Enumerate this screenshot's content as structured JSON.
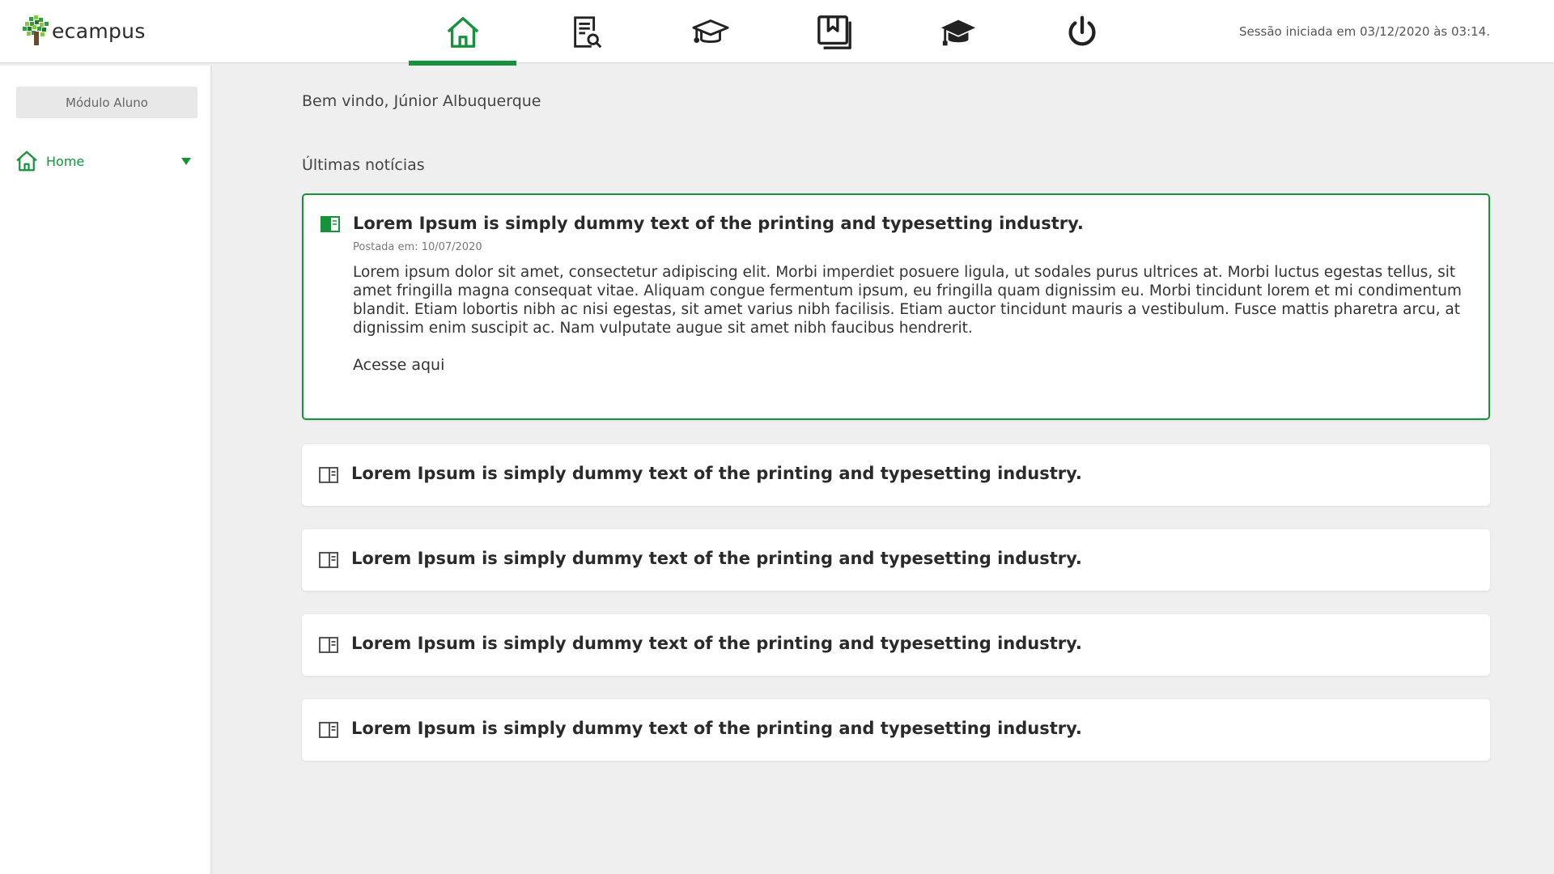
{
  "app": {
    "name": "ecampus"
  },
  "colors": {
    "accent": "#16923c",
    "icon_dark": "#222222",
    "background": "#efefef"
  },
  "header": {
    "nav": [
      {
        "icon": "home-icon",
        "active": true
      },
      {
        "icon": "document-search-icon",
        "active": false
      },
      {
        "icon": "graduation-cap-outline-icon",
        "active": false
      },
      {
        "icon": "bookmark-book-icon",
        "active": false
      },
      {
        "icon": "graduation-cap-solid-icon",
        "active": false
      },
      {
        "icon": "power-icon",
        "active": false
      }
    ],
    "session": "Sessão iniciada em 03/12/2020 às 03:14."
  },
  "sidebar": {
    "module_label": "Módulo Aluno",
    "items": [
      {
        "label": "Home",
        "icon": "home-icon"
      }
    ]
  },
  "main": {
    "welcome": "Bem vindo, Júnior Albuquerque",
    "news_title": "Últimas notícias",
    "news": [
      {
        "title": "Lorem Ipsum is simply dummy text of the printing and typesetting industry.",
        "date": "Postada em: 10/07/2020",
        "body": "Lorem ipsum dolor sit amet, consectetur adipiscing elit. Morbi imperdiet posuere ligula, ut sodales purus ultrices at. Morbi luctus egestas tellus, sit amet fringilla magna consequat vitae. Aliquam congue fermentum ipsum, eu fringilla quam dignissim eu. Morbi tincidunt lorem et mi condimentum blandit. Etiam lobortis nibh ac nisi egestas, sit amet varius nibh facilisis. Etiam auctor tincidunt mauris a vestibulum. Fusce mattis pharetra arcu, at dignissim enim suscipit ac. Nam vulputate augue sit amet nibh faucibus hendrerit.",
        "link": "Acesse aqui"
      },
      {
        "title": "Lorem Ipsum is simply dummy text of the printing and typesetting industry."
      },
      {
        "title": "Lorem Ipsum is simply dummy text of the printing and typesetting industry."
      },
      {
        "title": "Lorem Ipsum is simply dummy text of the printing and typesetting industry."
      },
      {
        "title": "Lorem Ipsum is simply dummy text of the printing and typesetting industry."
      }
    ]
  }
}
